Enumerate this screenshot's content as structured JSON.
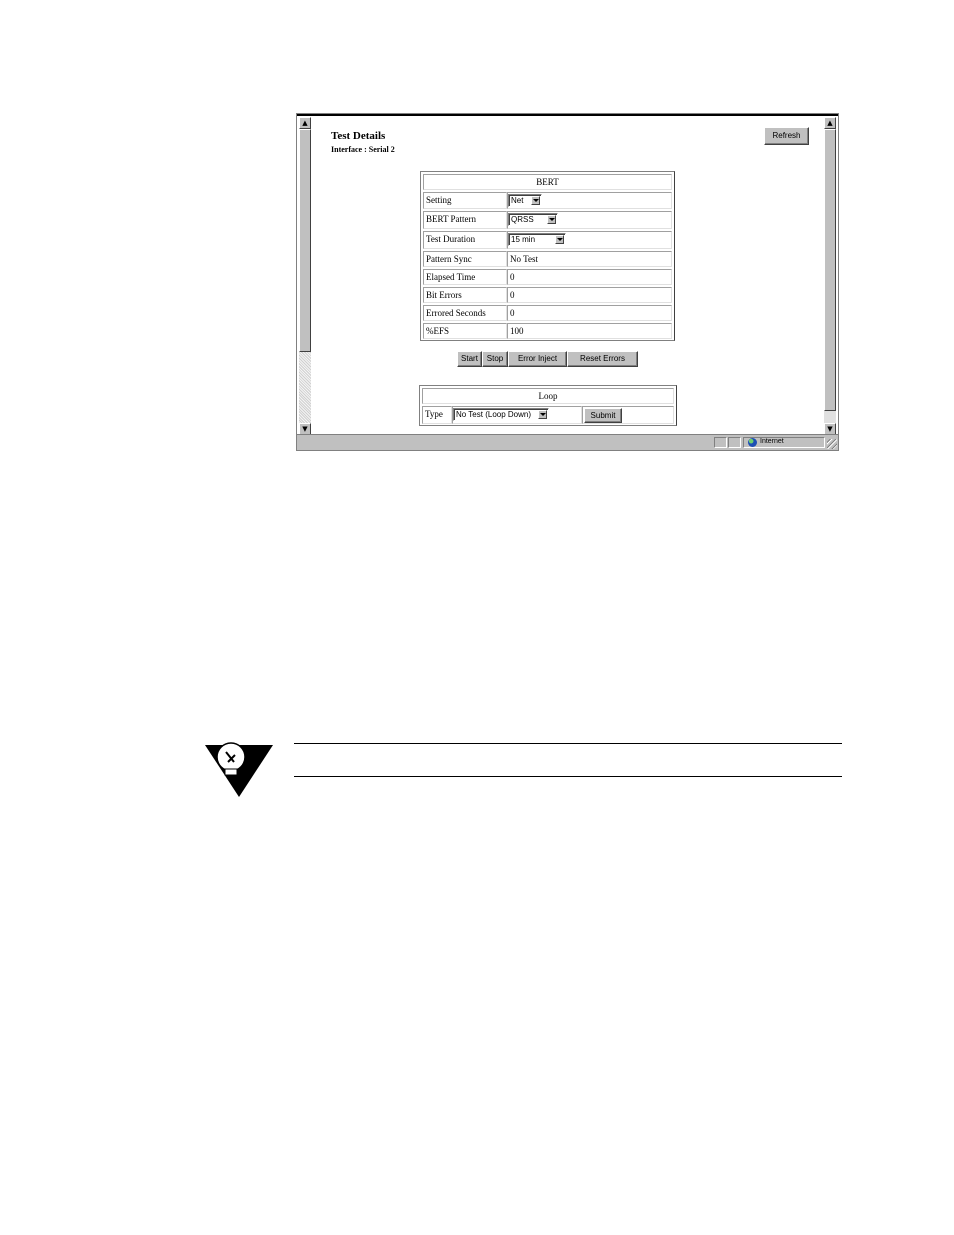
{
  "window": {
    "status": {
      "zone": "Internet"
    }
  },
  "page": {
    "title": "Test Details",
    "subtitle": "Interface : Serial 2",
    "refresh_label": "Refresh"
  },
  "bert": {
    "header": "BERT",
    "rows": [
      {
        "label": "Setting",
        "value": "Net"
      },
      {
        "label": "BERT Pattern",
        "value": "QRSS"
      },
      {
        "label": "Test Duration",
        "value": "15 min"
      },
      {
        "label": "Pattern Sync",
        "value": "No Test"
      },
      {
        "label": "Elapsed Time",
        "value": "0"
      },
      {
        "label": "Bit Errors",
        "value": "0"
      },
      {
        "label": "Errored Seconds",
        "value": "0"
      },
      {
        "label": "%EFS",
        "value": "100"
      }
    ]
  },
  "actions": {
    "start": "Start",
    "stop": "Stop",
    "error_inject": "Error Inject",
    "reset_errors": "Reset Errors"
  },
  "loop": {
    "header": "Loop",
    "type_label": "Type",
    "type_value": "No Test (Loop Down)",
    "submit_label": "Submit"
  },
  "icons": {
    "note": "lightbulb-note-icon",
    "status_zone": "globe-icon"
  }
}
